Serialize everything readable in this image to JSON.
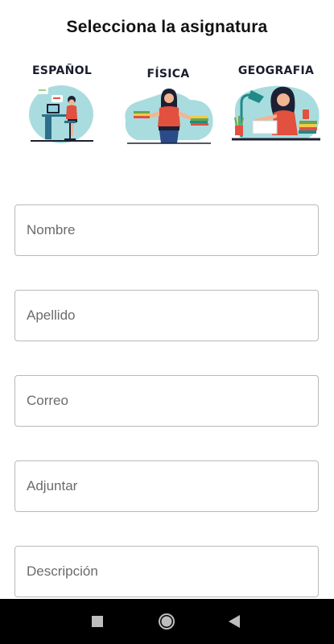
{
  "page": {
    "title": "Selecciona la asignatura"
  },
  "subjects": [
    {
      "label": "ESPAÑOL",
      "illustration": "office-worker-at-desk-illustration"
    },
    {
      "label": "FÍSICA",
      "illustration": "teacher-holding-books-illustration"
    },
    {
      "label": "GEOGRAFIA",
      "illustration": "student-studying-with-lamp-illustration"
    }
  ],
  "form": {
    "fields": [
      {
        "placeholder": "Nombre",
        "value": ""
      },
      {
        "placeholder": "Apellido",
        "value": ""
      },
      {
        "placeholder": "Correo",
        "value": ""
      },
      {
        "placeholder": "Adjuntar",
        "value": ""
      },
      {
        "placeholder": "Descripción",
        "value": ""
      }
    ]
  },
  "nav": {
    "buttons": [
      "recents-square-icon",
      "home-circle-icon",
      "back-triangle-icon"
    ]
  },
  "colors": {
    "illustration_bg": "#a9dcdf",
    "accent_red": "#e2503f",
    "dark_navy": "#1d2033",
    "skin": "#f2b591",
    "book_green": "#6aa64a",
    "book_yellow": "#f2c94c",
    "lamp_teal": "#1f8a88"
  }
}
